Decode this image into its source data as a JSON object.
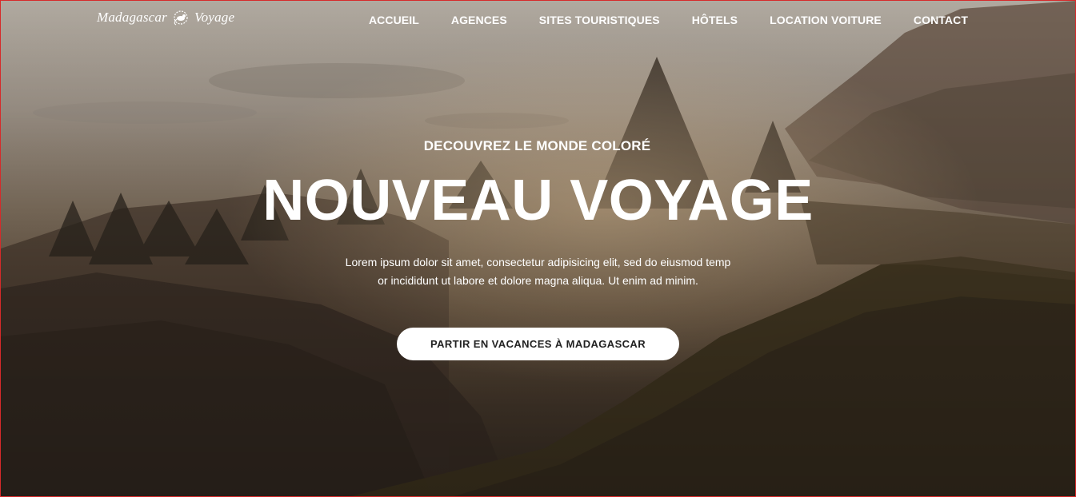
{
  "logo": {
    "text_left": "Madagascar",
    "text_right": "Voyage",
    "icon": "lemur-icon"
  },
  "nav": {
    "items": [
      {
        "label": "ACCUEIL"
      },
      {
        "label": "AGENCES"
      },
      {
        "label": "SITES TOURISTIQUES"
      },
      {
        "label": "HÔTELS"
      },
      {
        "label": "LOCATION VOITURE"
      },
      {
        "label": "CONTACT"
      }
    ]
  },
  "hero": {
    "subtitle": "DECOUVREZ LE MONDE COLORÉ",
    "title": "NOUVEAU VOYAGE",
    "description_line1": "Lorem ipsum dolor sit amet, consectetur adipisicing elit, sed do eiusmod temp",
    "description_line2": "or incididunt ut labore et dolore magna aliqua. Ut enim ad minim.",
    "cta_label": "PARTIR EN VACANCES À MADAGASCAR"
  },
  "colors": {
    "nav_text": "#ffffff",
    "cta_background": "#ffffff",
    "cta_text": "#222222",
    "frame_border": "#d62a2a"
  }
}
